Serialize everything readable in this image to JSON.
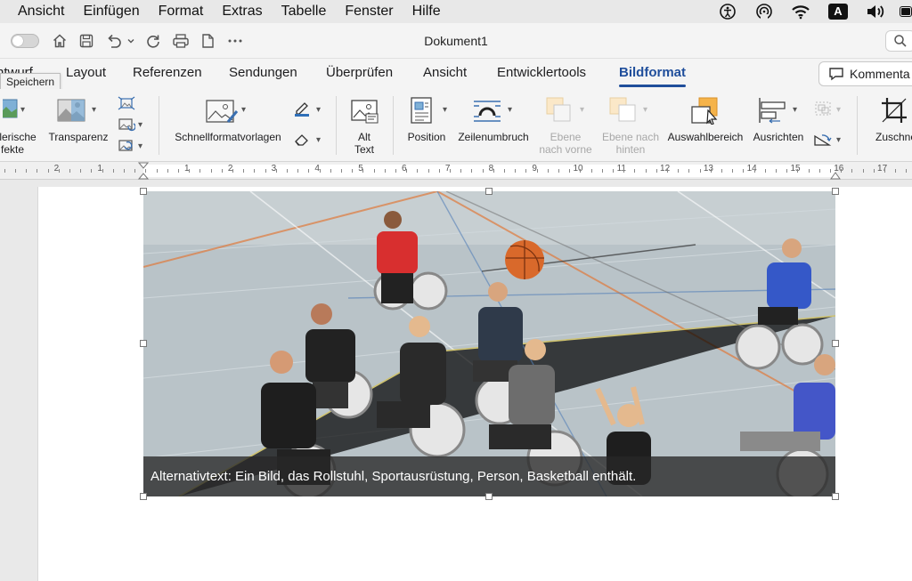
{
  "menubar": {
    "items": [
      "Ansicht",
      "Einfügen",
      "Format",
      "Extras",
      "Tabelle",
      "Fenster",
      "Hilfe"
    ],
    "status_icons": [
      "accessibility-icon",
      "airdrop-icon",
      "wifi-icon",
      "input-source-icon",
      "volume-icon",
      "battery-icon"
    ],
    "input_source_label": "A"
  },
  "titlebar": {
    "title": "Dokument1",
    "quick_access_icons": [
      "autosave-toggle",
      "home-icon",
      "save-icon",
      "undo-icon",
      "redo-icon",
      "print-icon",
      "new-document-icon",
      "more-icon"
    ]
  },
  "tabs": {
    "items": [
      "ntwurf",
      "Layout",
      "Referenzen",
      "Sendungen",
      "Überprüfen",
      "Ansicht",
      "Entwicklertools",
      "Bildformat"
    ],
    "active": "Bildformat",
    "comment_label": "Kommenta"
  },
  "tooltip": {
    "text": "Speichern"
  },
  "ribbon": {
    "artistic_label_1": "lerische",
    "artistic_label_2": "fekte",
    "transparency_label": "Transparenz",
    "quick_styles_label": "Schnellformatvorlagen",
    "alt_text_label_1": "Alt",
    "alt_text_label_2": "Text",
    "position_label": "Position",
    "wrap_text_label": "Zeilenumbruch",
    "bring_forward_label_1": "Ebene",
    "bring_forward_label_2": "nach vorne",
    "send_backward_label_1": "Ebene nach",
    "send_backward_label_2": "hinten",
    "selection_pane_label": "Auswahlbereich",
    "align_label": "Ausrichten",
    "crop_label": "Zuschne"
  },
  "ruler": {
    "left_numbers": [
      "2",
      "1"
    ],
    "right_numbers": [
      "1",
      "2",
      "3",
      "4",
      "5",
      "6",
      "7",
      "8",
      "9",
      "10",
      "11",
      "12",
      "13",
      "14",
      "15",
      "16",
      "17"
    ]
  },
  "document": {
    "alt_text": "Alternativtext: Ein Bild, das Rollstuhl, Sportausrüstung,  Person, Basketball enthält."
  },
  "colors": {
    "accent": "#1f4e9b",
    "court_floor": "#b9c3c8",
    "basketball": "#d9692b"
  }
}
